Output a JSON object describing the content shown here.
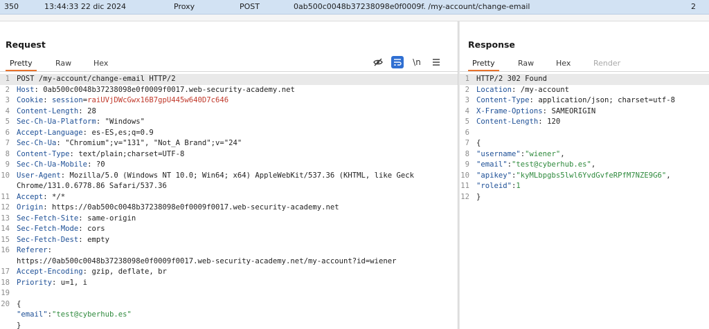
{
  "history_row": {
    "num": "350",
    "time": "13:44:33 22 dic 2024",
    "tool": "Proxy",
    "method": "POST",
    "url": "0ab500c0048b37238098e0f0009f. /my-account/change-email",
    "count": "2"
  },
  "request": {
    "title": "Request",
    "tabs": [
      "Pretty",
      "Raw",
      "Hex"
    ],
    "active_tab": "Pretty",
    "tool_icons": [
      "eye-slash-icon",
      "wrap-lines-icon",
      "newline-icon",
      "menu-icon"
    ],
    "newline_label": "\\n",
    "lines": [
      {
        "n": "1",
        "text": "POST /my-account/change-email HTTP/2"
      },
      {
        "n": "2",
        "key": "Host",
        "val": "0ab500c0048b37238098e0f0009f0017.web-security-academy.net"
      },
      {
        "n": "3",
        "key": "Cookie",
        "cookie_name": "session",
        "cookie_val": "raiUVjDWcGwx16B7gpU445w640D7c646"
      },
      {
        "n": "4",
        "key": "Content-Length",
        "val": "28"
      },
      {
        "n": "5",
        "key": "Sec-Ch-Ua-Platform",
        "val": "\"Windows\""
      },
      {
        "n": "6",
        "key": "Accept-Language",
        "val": "es-ES,es;q=0.9"
      },
      {
        "n": "7",
        "key": "Sec-Ch-Ua",
        "val": "\"Chromium\";v=\"131\", \"Not_A Brand\";v=\"24\""
      },
      {
        "n": "8",
        "key": "Content-Type",
        "val": "text/plain;charset=UTF-8"
      },
      {
        "n": "9",
        "key": "Sec-Ch-Ua-Mobile",
        "val": "?0"
      },
      {
        "n": "10",
        "key": "User-Agent",
        "val": "Mozilla/5.0 (Windows NT 10.0; Win64; x64) AppleWebKit/537.36 (KHTML, like Geck"
      },
      {
        "n": "",
        "text": "Chrome/131.0.6778.86 Safari/537.36"
      },
      {
        "n": "11",
        "key": "Accept",
        "val": "*/*"
      },
      {
        "n": "12",
        "key": "Origin",
        "val": "https://0ab500c0048b37238098e0f0009f0017.web-security-academy.net"
      },
      {
        "n": "13",
        "key": "Sec-Fetch-Site",
        "val": "same-origin"
      },
      {
        "n": "14",
        "key": "Sec-Fetch-Mode",
        "val": "cors"
      },
      {
        "n": "15",
        "key": "Sec-Fetch-Dest",
        "val": "empty"
      },
      {
        "n": "16",
        "key": "Referer",
        "val": ""
      },
      {
        "n": "",
        "text": "https://0ab500c0048b37238098e0f0009f0017.web-security-academy.net/my-account?id=wiener"
      },
      {
        "n": "17",
        "key": "Accept-Encoding",
        "val": "gzip, deflate, br"
      },
      {
        "n": "18",
        "key": "Priority",
        "val": "u=1, i"
      },
      {
        "n": "19",
        "text": ""
      },
      {
        "n": "20",
        "text": "{"
      },
      {
        "n": "",
        "jkey": "\"email\"",
        "jval": "\"test@cyberhub.es\"",
        "comma": ""
      },
      {
        "n": "",
        "text": "}"
      }
    ]
  },
  "response": {
    "title": "Response",
    "tabs": [
      "Pretty",
      "Raw",
      "Hex",
      "Render"
    ],
    "active_tab": "Pretty",
    "lines": [
      {
        "n": "1",
        "text": "HTTP/2 302 Found"
      },
      {
        "n": "2",
        "key": "Location",
        "val": "/my-account"
      },
      {
        "n": "3",
        "key": "Content-Type",
        "val": "application/json; charset=utf-8"
      },
      {
        "n": "4",
        "key": "X-Frame-Options",
        "val": "SAMEORIGIN"
      },
      {
        "n": "5",
        "key": "Content-Length",
        "val": "120"
      },
      {
        "n": "6",
        "text": ""
      },
      {
        "n": "7",
        "text": "{"
      },
      {
        "n": "8",
        "jkey": "\"username\"",
        "jval": "\"wiener\"",
        "comma": ","
      },
      {
        "n": "9",
        "jkey": "\"email\"",
        "jval": "\"test@cyberhub.es\"",
        "comma": ","
      },
      {
        "n": "10",
        "jkey": "\"apikey\"",
        "jval": "\"kyMLbpgbs5lwl6YvdGvfeRPfM7NZE9G6\"",
        "comma": ","
      },
      {
        "n": "11",
        "jkey": "\"roleid\"",
        "jval": "1",
        "comma": ""
      },
      {
        "n": "12",
        "text": "}"
      }
    ]
  },
  "colors": {
    "accent_tab_underline": "#e8722b",
    "header_key": "#1d4f96",
    "cookie_value": "#c0392b",
    "json_value": "#2f8a3d",
    "selected_row": "#d2e2f3"
  }
}
